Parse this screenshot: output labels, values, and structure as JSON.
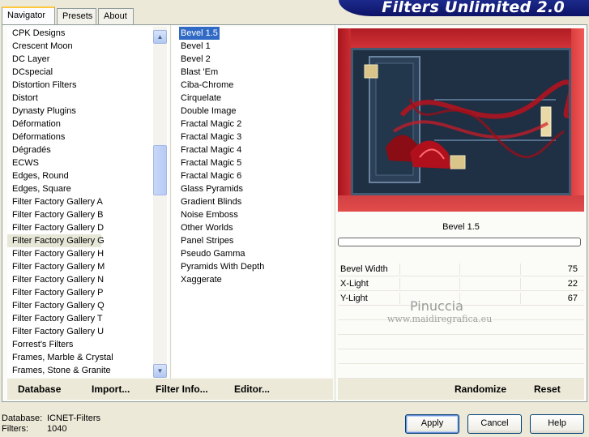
{
  "tabs": [
    "Navigator",
    "Presets",
    "About"
  ],
  "banner_title": "Filters Unlimited 2.0",
  "categories": [
    "CPK Designs",
    "Crescent Moon",
    "DC Layer",
    "DCspecial",
    "Distortion Filters",
    "Distort",
    "Dynasty Plugins",
    "Déformation",
    "Déformations",
    "Dégradés",
    "ECWS",
    "Edges, Round",
    "Edges, Square",
    "Filter Factory Gallery A",
    "Filter Factory Gallery B",
    "Filter Factory Gallery D",
    "Filter Factory Gallery G",
    "Filter Factory Gallery H",
    "Filter Factory Gallery M",
    "Filter Factory Gallery N",
    "Filter Factory Gallery P",
    "Filter Factory Gallery Q",
    "Filter Factory Gallery T",
    "Filter Factory Gallery U",
    "Forrest's Filters",
    "Frames, Marble & Crystal",
    "Frames, Stone & Granite"
  ],
  "selected_category": "Filter Factory Gallery G",
  "filters": [
    "Bevel 1.5",
    "Bevel 1",
    "Bevel 2",
    "Blast 'Em",
    "Ciba-Chrome",
    "Cirquelate",
    "Double Image",
    "Fractal Magic 2",
    "Fractal Magic 3",
    "Fractal Magic 4",
    "Fractal Magic 5",
    "Fractal Magic 6",
    "Glass Pyramids",
    "Gradient Blinds",
    "Noise Emboss",
    "Other Worlds",
    "Panel Stripes",
    "Pseudo Gamma",
    "Pyramids With Depth",
    "Xaggerate"
  ],
  "selected_filter": "Bevel 1.5",
  "links": {
    "database": "Database",
    "import": "Import...",
    "filter_info": "Filter Info...",
    "editor": "Editor...",
    "randomize": "Randomize",
    "reset": "Reset"
  },
  "current_filter_name": "Bevel 1.5",
  "params": [
    {
      "name": "Bevel Width",
      "value": "75"
    },
    {
      "name": "X-Light",
      "value": "22"
    },
    {
      "name": "Y-Light",
      "value": "67"
    }
  ],
  "watermark": {
    "line1": "Pinuccia",
    "line2": "www.maidiregrafica.eu"
  },
  "footer": {
    "database_label": "Database:",
    "database_value": "ICNET-Filters",
    "filters_label": "Filters:",
    "filters_value": "1040"
  },
  "buttons": {
    "apply": "Apply",
    "cancel": "Cancel",
    "help": "Help"
  },
  "icons": {
    "scroll_up": "chevron-up-icon",
    "scroll_down": "chevron-down-icon"
  },
  "colors": {
    "selection": "#316ac5",
    "banner": "#1c2a8c",
    "preview_frame": "#c92b2e"
  }
}
